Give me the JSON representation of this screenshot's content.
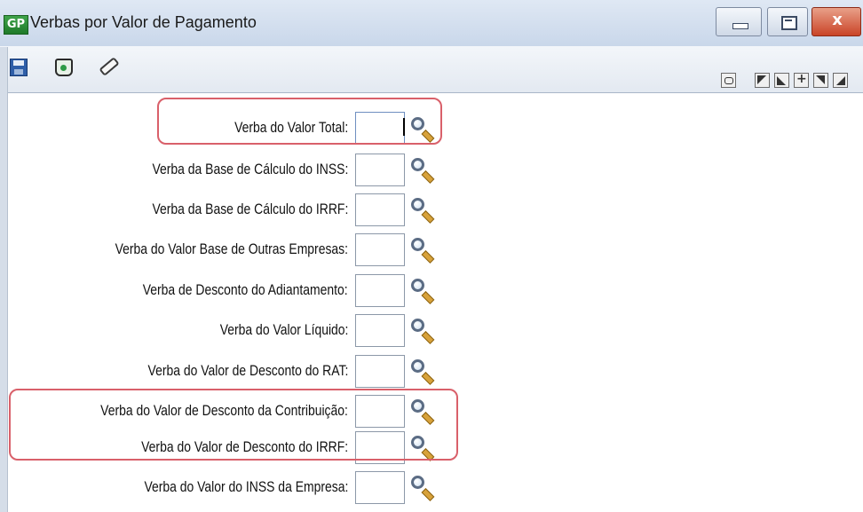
{
  "window": {
    "app_icon": "GP",
    "title": "Verbas por Valor de Pagamento",
    "controls": {
      "close": "x"
    }
  },
  "toolbar": {
    "left_icons": [
      "save-icon",
      "trash-icon",
      "eraser-icon"
    ],
    "right_icons": [
      "camera-icon",
      "first-record-icon",
      "prev-record-icon",
      "locate-icon",
      "next-record-icon",
      "last-record-icon"
    ]
  },
  "form": {
    "rows": [
      {
        "label": "Verba do Valor Total:",
        "value": ""
      },
      {
        "label": "Verba da Base de Cálculo do INSS:",
        "value": ""
      },
      {
        "label": "Verba da Base de Cálculo do IRRF:",
        "value": ""
      },
      {
        "label": "Verba do Valor Base de Outras Empresas:",
        "value": ""
      },
      {
        "label": "Verba de Desconto do Adiantamento:",
        "value": ""
      },
      {
        "label": "Verba do Valor Líquido:",
        "value": ""
      },
      {
        "label": "Verba do Valor de Desconto do RAT:",
        "value": ""
      },
      {
        "label": "Verba do Valor de Desconto da Contribuição:",
        "value": ""
      },
      {
        "label": "Verba do Valor de Desconto do IRRF:",
        "value": ""
      },
      {
        "label": "Verba do Valor do INSS da Empresa:",
        "value": ""
      }
    ]
  },
  "colors": {
    "highlight": "#d9606a",
    "titlebar": "#c9d7ea",
    "close_button": "#c94427"
  }
}
